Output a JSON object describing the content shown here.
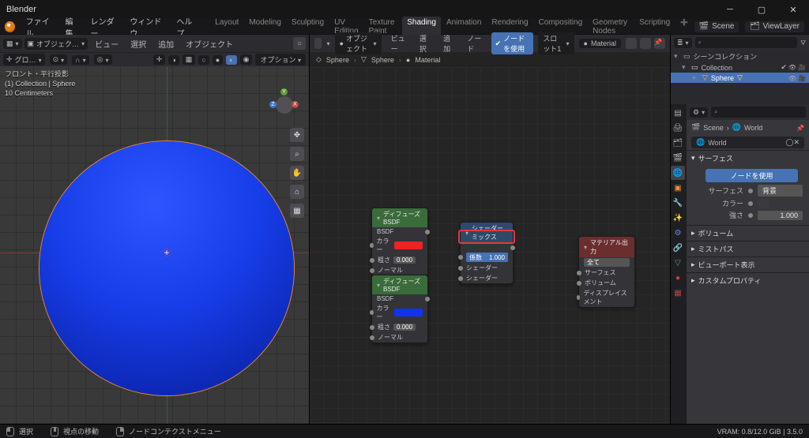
{
  "window": {
    "title": "Blender"
  },
  "menubar": {
    "items": [
      "ファイル",
      "編集",
      "レンダー",
      "ウィンドウ",
      "ヘルプ"
    ],
    "workspaces": [
      "Layout",
      "Modeling",
      "Sculpting",
      "UV Editing",
      "Texture Paint",
      "Shading",
      "Animation",
      "Rendering",
      "Compositing",
      "Geometry Nodes",
      "Scripting"
    ],
    "active_workspace": 5,
    "scene_label": "Scene",
    "viewlayer_label": "ViewLayer"
  },
  "viewport": {
    "header": {
      "mode": "オブジェク…",
      "menus": [
        "ビュー",
        "選択",
        "追加",
        "オブジェクト"
      ],
      "transform": "グロ…"
    },
    "header2": {
      "options": "オプション"
    },
    "overlay": {
      "line1": "フロント・平行投影",
      "line2": "(1) Collection | Sphere",
      "line3": "10 Centimeters"
    },
    "side_icons": [
      "✥",
      "⌕",
      "✋",
      "⌂",
      "▦"
    ]
  },
  "shader": {
    "type_label": "オブジェクト",
    "menus": [
      "ビュー",
      "選択",
      "追加",
      "ノード"
    ],
    "use_nodes": "ノードを使用",
    "slot": "スロット1",
    "material": "Material",
    "breadcrumb": [
      "Sphere",
      "Sphere",
      "Material"
    ],
    "nodes": {
      "diffuse_red": {
        "title": "ディフューズBSDF",
        "bsdf": "BSDF",
        "color_lab": "カラー",
        "rough_lab": "粗さ",
        "rough": "0.000",
        "normal_lab": "ノーマル"
      },
      "diffuse_blue": {
        "title": "ディフューズBSDF",
        "bsdf": "BSDF",
        "color_lab": "カラー",
        "rough_lab": "粗さ",
        "rough": "0.000",
        "normal_lab": "ノーマル"
      },
      "mix": {
        "title": "シェーダーミックス",
        "fac_lab": "係数",
        "fac": "1.000",
        "shader1": "シェーダー",
        "shader2": "シェーダー"
      },
      "output": {
        "title": "マテリアル出力",
        "all": "全て",
        "surface": "サーフェス",
        "volume": "ボリューム",
        "disp": "ディスプレイスメント"
      }
    }
  },
  "outliner": {
    "root": "シーンコレクション",
    "collection": "Collection",
    "object": "Sphere"
  },
  "properties": {
    "breadcrumb_scene": "Scene",
    "breadcrumb_world": "World",
    "datablock": "World",
    "panels": {
      "surface": {
        "title": "サーフェス",
        "use_nodes": "ノードを使用",
        "surface_lab": "サーフェス",
        "surface_val": "背景",
        "color_lab": "カラー",
        "strength_lab": "強さ",
        "strength_val": "1.000"
      },
      "volume": "ボリューム",
      "mist": "ミストパス",
      "viewport": "ビューポート表示",
      "custom": "カスタムプロパティ"
    }
  },
  "statusbar": {
    "select": "選択",
    "move": "視点の移動",
    "ctx": "ノードコンテクストメニュー",
    "vram": "VRAM: 0.8/12.0 GiB",
    "ver": "3.5.0"
  }
}
